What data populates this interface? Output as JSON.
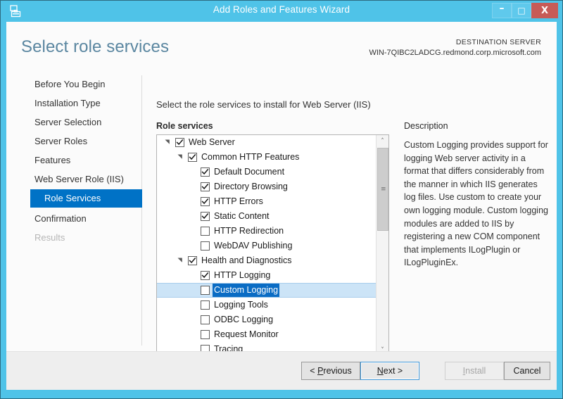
{
  "window": {
    "title": "Add Roles and Features Wizard",
    "icon": "wizard-toolbox-icon",
    "controls": {
      "minimize": "–",
      "maximize": "□",
      "close": "X"
    },
    "accent_color": "#4fc3e8",
    "close_color": "#c75b57"
  },
  "header": {
    "page_title": "Select role services",
    "destination_label": "DESTINATION SERVER",
    "destination_server": "WIN-7QIBC2LADCG.redmond.corp.microsoft.com"
  },
  "sidebar": {
    "items": [
      {
        "label": "Before You Begin",
        "state": "normal"
      },
      {
        "label": "Installation Type",
        "state": "normal"
      },
      {
        "label": "Server Selection",
        "state": "normal"
      },
      {
        "label": "Server Roles",
        "state": "normal"
      },
      {
        "label": "Features",
        "state": "normal"
      },
      {
        "label": "Web Server Role (IIS)",
        "state": "normal"
      },
      {
        "label": "Role Services",
        "state": "selected"
      },
      {
        "label": "Confirmation",
        "state": "normal"
      },
      {
        "label": "Results",
        "state": "disabled"
      }
    ],
    "selected_color": "#0072c6"
  },
  "main": {
    "instruction": "Select the role services to install for Web Server (IIS)",
    "tree_label": "Role services",
    "tree": [
      {
        "label": "Web Server",
        "level": 0,
        "checked": true,
        "expander": "expanded",
        "selected": false
      },
      {
        "label": "Common HTTP Features",
        "level": 1,
        "checked": true,
        "expander": "expanded",
        "selected": false
      },
      {
        "label": "Default Document",
        "level": 2,
        "checked": true,
        "expander": "none",
        "selected": false
      },
      {
        "label": "Directory Browsing",
        "level": 2,
        "checked": true,
        "expander": "none",
        "selected": false
      },
      {
        "label": "HTTP Errors",
        "level": 2,
        "checked": true,
        "expander": "none",
        "selected": false
      },
      {
        "label": "Static Content",
        "level": 2,
        "checked": true,
        "expander": "none",
        "selected": false
      },
      {
        "label": "HTTP Redirection",
        "level": 2,
        "checked": false,
        "expander": "none",
        "selected": false
      },
      {
        "label": "WebDAV Publishing",
        "level": 2,
        "checked": false,
        "expander": "none",
        "selected": false
      },
      {
        "label": "Health and Diagnostics",
        "level": 1,
        "checked": true,
        "expander": "expanded",
        "selected": false
      },
      {
        "label": "HTTP Logging",
        "level": 2,
        "checked": true,
        "expander": "none",
        "selected": false
      },
      {
        "label": "Custom Logging",
        "level": 2,
        "checked": false,
        "expander": "none",
        "selected": true
      },
      {
        "label": "Logging Tools",
        "level": 2,
        "checked": false,
        "expander": "none",
        "selected": false
      },
      {
        "label": "ODBC Logging",
        "level": 2,
        "checked": false,
        "expander": "none",
        "selected": false
      },
      {
        "label": "Request Monitor",
        "level": 2,
        "checked": false,
        "expander": "none",
        "selected": false
      },
      {
        "label": "Tracing",
        "level": 2,
        "checked": false,
        "expander": "none",
        "selected": false
      }
    ],
    "selection_highlight_color": "#0a6cc4",
    "selection_row_color": "#cce4f7"
  },
  "description": {
    "label": "Description",
    "text": "Custom Logging provides support for logging Web server activity in a format that differs considerably from the manner in which IIS generates log files. Use custom to create your own logging module. Custom logging modules are added to IIS by registering a new COM component that implements ILogPlugin or ILogPluginEx."
  },
  "scrollbars": {
    "vertical": {
      "up": "˄",
      "down": "˅",
      "grip": "≡"
    },
    "horizontal": {
      "left": "‹",
      "right": "›",
      "grip": "‖‖"
    }
  },
  "footer": {
    "previous": {
      "pre": "< ",
      "accel": "P",
      "post": "revious",
      "state": "normal"
    },
    "next": {
      "pre": "",
      "accel": "N",
      "post": "ext >",
      "state": "focused"
    },
    "install": {
      "pre": "",
      "accel": "I",
      "post": "nstall",
      "state": "disabled"
    },
    "cancel": {
      "pre": "",
      "accel": "",
      "post": "Cancel",
      "state": "normal"
    }
  }
}
